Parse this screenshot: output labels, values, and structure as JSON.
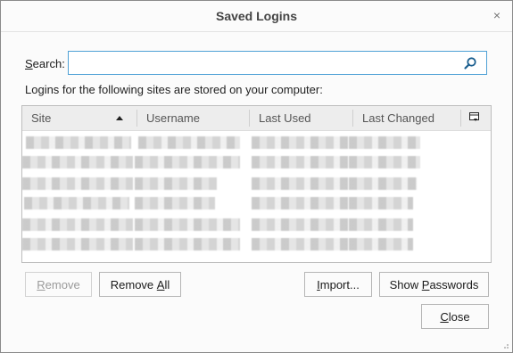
{
  "dialog": {
    "title": "Saved Logins",
    "close_glyph": "×"
  },
  "search": {
    "label": "Search:",
    "value": "",
    "placeholder": "",
    "icon": "magnifier-icon"
  },
  "info_text": "Logins for the following sites are stored on your computer:",
  "table": {
    "columns": [
      "Site",
      "Username",
      "Last Used",
      "Last Changed"
    ],
    "sort_column": "Site",
    "sort_direction": "ascending",
    "column_picker_icon": "column-picker-icon",
    "row_count": 6,
    "rows_obscured": true
  },
  "buttons": {
    "remove": "Remove",
    "remove_all": "Remove All",
    "import": "Import...",
    "show_passwords": "Show Passwords",
    "close": "Close"
  },
  "colors": {
    "accent": "#4fa1d6",
    "dialog_bg": "#fbfbfb",
    "header_bg": "#ededed"
  }
}
